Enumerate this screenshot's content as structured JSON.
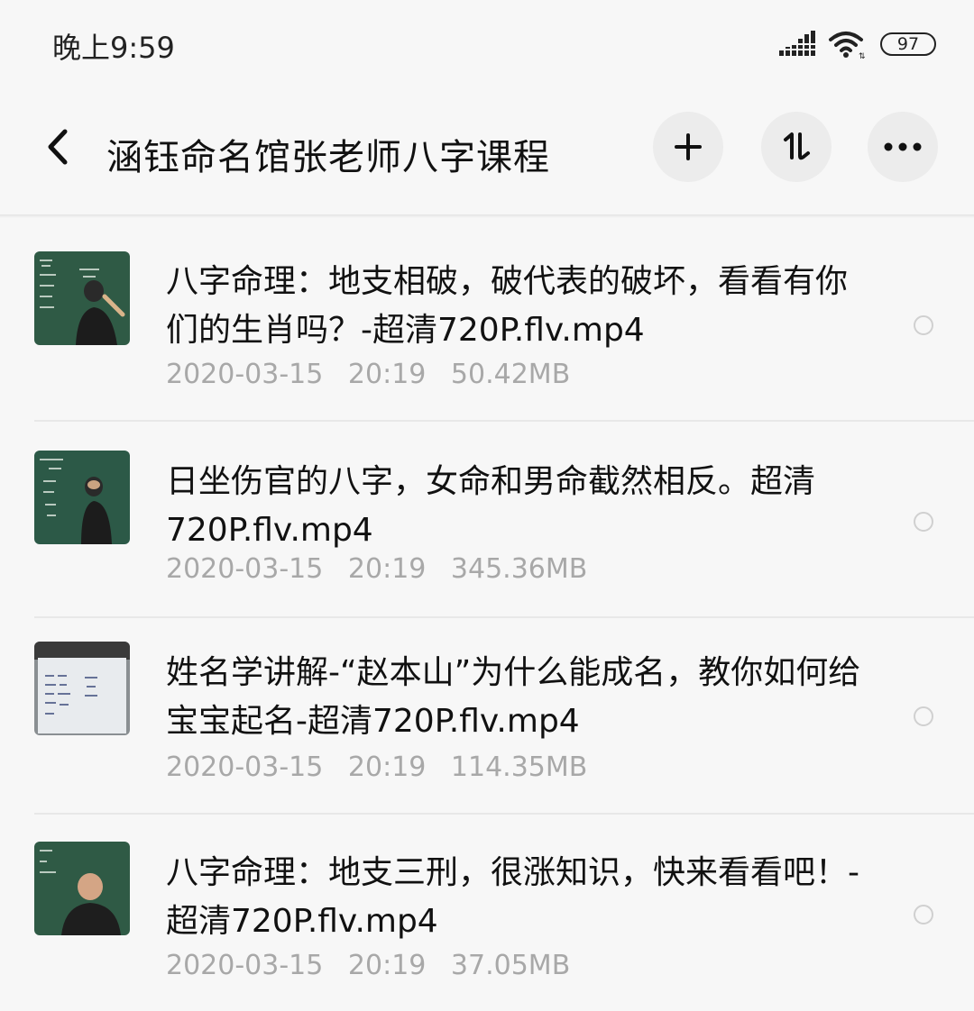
{
  "status_bar": {
    "time": "晚上9:59",
    "battery": "97"
  },
  "header": {
    "title": "涵钰命名馆张老师八字课程"
  },
  "files": [
    {
      "name": "八字命理：地支相破，破代表的破坏，看看有你们的生肖吗？-超清720P.flv.mp4",
      "date": "2020-03-15",
      "time": "20:19",
      "size": "50.42MB"
    },
    {
      "name": "日坐伤官的八字，女命和男命截然相反。超清720P.flv.mp4",
      "date": "2020-03-15",
      "time": "20:19",
      "size": "345.36MB"
    },
    {
      "name": "姓名学讲解-“赵本山”为什么能成名，教你如何给宝宝起名-超清720P.flv.mp4",
      "date": "2020-03-15",
      "time": "20:19",
      "size": "114.35MB"
    },
    {
      "name": "八字命理：地支三刑，很涨知识，快来看看吧！-超清720P.flv.mp4",
      "date": "2020-03-15",
      "time": "20:19",
      "size": "37.05MB"
    }
  ]
}
